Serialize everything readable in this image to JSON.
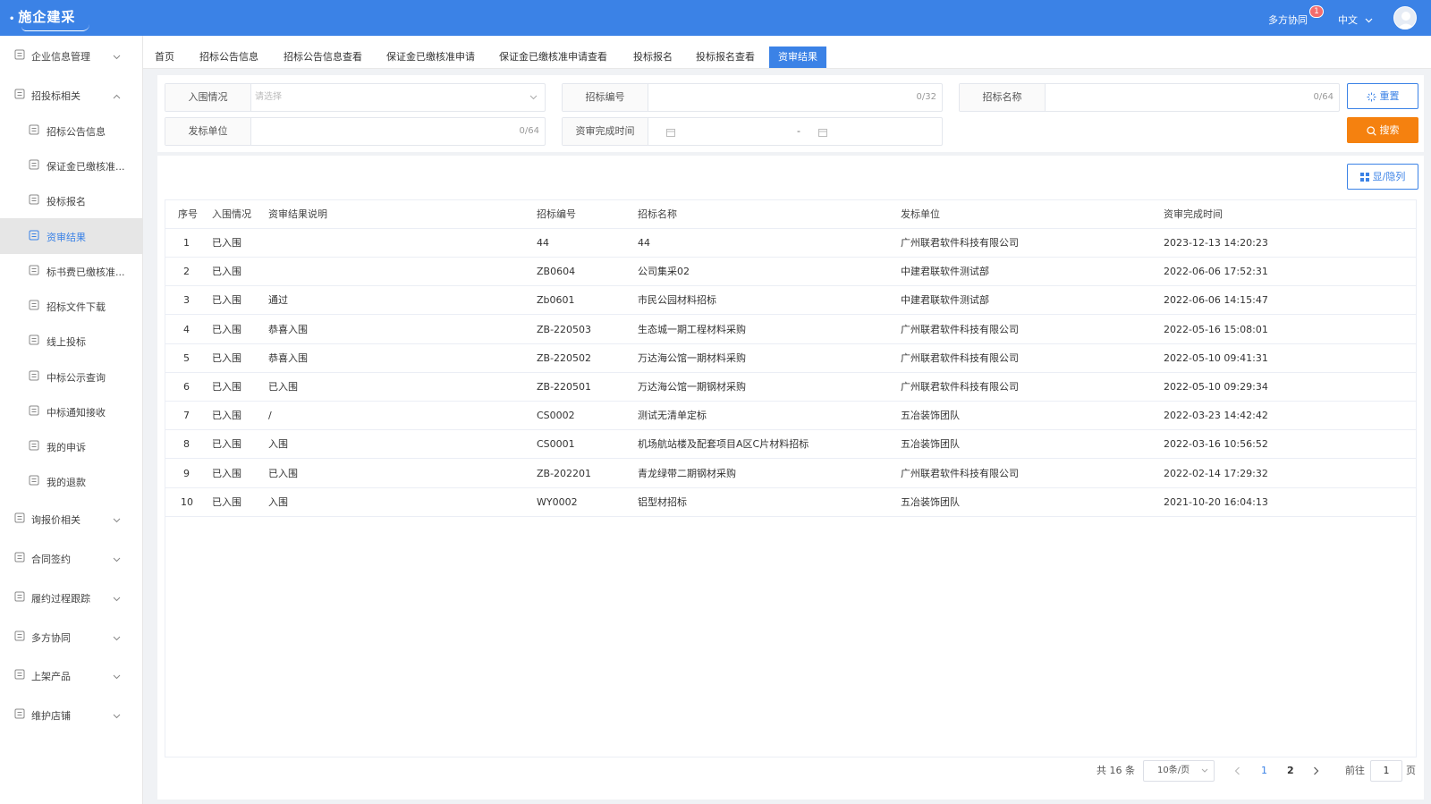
{
  "header": {
    "logo": "施企建采",
    "collab_label": "多方协同",
    "notification_count": "1",
    "language": "中文"
  },
  "sidebar": {
    "items": [
      {
        "label": "企业信息管理",
        "icon": "document-icon",
        "expanded": false
      },
      {
        "label": "招投标相关",
        "icon": "target-icon",
        "expanded": true
      },
      {
        "label": "招标公告信息",
        "icon": "notice-icon",
        "sub": true
      },
      {
        "label": "保证金已缴核准...",
        "icon": "clipboard-icon",
        "sub": true
      },
      {
        "label": "投标报名",
        "icon": "user-icon",
        "sub": true
      },
      {
        "label": "资审结果",
        "icon": "checklist-icon",
        "sub": true,
        "active": true
      },
      {
        "label": "标书费已缴核准...",
        "icon": "receipt-icon",
        "sub": true
      },
      {
        "label": "招标文件下载",
        "icon": "org-icon",
        "sub": true
      },
      {
        "label": "线上投标",
        "icon": "file-edit-icon",
        "sub": true
      },
      {
        "label": "中标公示查询",
        "icon": "list-icon",
        "sub": true
      },
      {
        "label": "中标通知接收",
        "icon": "user-notify-icon",
        "sub": true
      },
      {
        "label": "我的申诉",
        "icon": "appeal-icon",
        "sub": true
      },
      {
        "label": "我的退款",
        "icon": "refund-icon",
        "sub": true
      },
      {
        "label": "询报价相关",
        "icon": "quote-icon",
        "expanded": false
      },
      {
        "label": "合同签约",
        "icon": "contract-icon",
        "expanded": false
      },
      {
        "label": "履约过程跟踪",
        "icon": "tracking-icon",
        "expanded": false
      },
      {
        "label": "多方协同",
        "icon": "collab-icon",
        "expanded": false
      },
      {
        "label": "上架产品",
        "icon": "product-icon",
        "expanded": false
      },
      {
        "label": "维护店铺",
        "icon": "shop-icon",
        "expanded": false
      }
    ]
  },
  "tabs": [
    {
      "label": "首页"
    },
    {
      "label": "招标公告信息"
    },
    {
      "label": "招标公告信息查看"
    },
    {
      "label": "保证金已缴核准申请"
    },
    {
      "label": "保证金已缴核准申请查看"
    },
    {
      "label": "投标报名"
    },
    {
      "label": "投标报名查看"
    },
    {
      "label": "资审结果",
      "active": true
    }
  ],
  "filters": {
    "status_label": "入围情况",
    "status_placeholder": "请选择",
    "bid_no_label": "招标编号",
    "bid_no_count": "0/32",
    "bid_name_label": "招标名称",
    "bid_name_count": "0/64",
    "issuer_label": "发标单位",
    "issuer_count": "0/64",
    "time_label": "资审完成时间",
    "range_sep": "-",
    "reset_label": "重置",
    "search_label": "搜索",
    "columns_label": "显/隐列"
  },
  "table": {
    "headers": [
      "序号",
      "入围情况",
      "资审结果说明",
      "招标编号",
      "招标名称",
      "发标单位",
      "资审完成时间"
    ],
    "rows": [
      [
        "1",
        "已入围",
        "",
        "44",
        "44",
        "广州联君软件科技有限公司",
        "2023-12-13 14:20:23"
      ],
      [
        "2",
        "已入围",
        "",
        "ZB0604",
        "公司集采02",
        "中建君联软件测试部",
        "2022-06-06 17:52:31"
      ],
      [
        "3",
        "已入围",
        "通过",
        "Zb0601",
        "市民公园材料招标",
        "中建君联软件测试部",
        "2022-06-06 14:15:47"
      ],
      [
        "4",
        "已入围",
        "恭喜入围",
        "ZB-220503",
        "生态城一期工程材料采购",
        "广州联君软件科技有限公司",
        "2022-05-16 15:08:01"
      ],
      [
        "5",
        "已入围",
        "恭喜入围",
        "ZB-220502",
        "万达海公馆一期材料采购",
        "广州联君软件科技有限公司",
        "2022-05-10 09:41:31"
      ],
      [
        "6",
        "已入围",
        "已入围",
        "ZB-220501",
        "万达海公馆一期钢材采购",
        "广州联君软件科技有限公司",
        "2022-05-10 09:29:34"
      ],
      [
        "7",
        "已入围",
        "/",
        "CS0002",
        "测试无清单定标",
        "五冶装饰团队",
        "2022-03-23 14:42:42"
      ],
      [
        "8",
        "已入围",
        "入围",
        "CS0001",
        "机场航站楼及配套项目A区C片材料招标",
        "五冶装饰团队",
        "2022-03-16 10:56:52"
      ],
      [
        "9",
        "已入围",
        "已入围",
        "ZB-202201",
        "青龙绿带二期钢材采购",
        "广州联君软件科技有限公司",
        "2022-02-14 17:29:32"
      ],
      [
        "10",
        "已入围",
        "入围",
        "WY0002",
        "铝型材招标",
        "五冶装饰团队",
        "2021-10-20 16:04:13"
      ]
    ]
  },
  "pagination": {
    "total_text": "共 16 条",
    "page_size": "10条/页",
    "pages": [
      "1",
      "2"
    ],
    "current_page": "1",
    "goto_label": "前往",
    "goto_value": "1",
    "page_unit": "页"
  },
  "colors": {
    "primary": "#3b82e6",
    "search": "#f5810f",
    "badge": "#f56c6c"
  }
}
